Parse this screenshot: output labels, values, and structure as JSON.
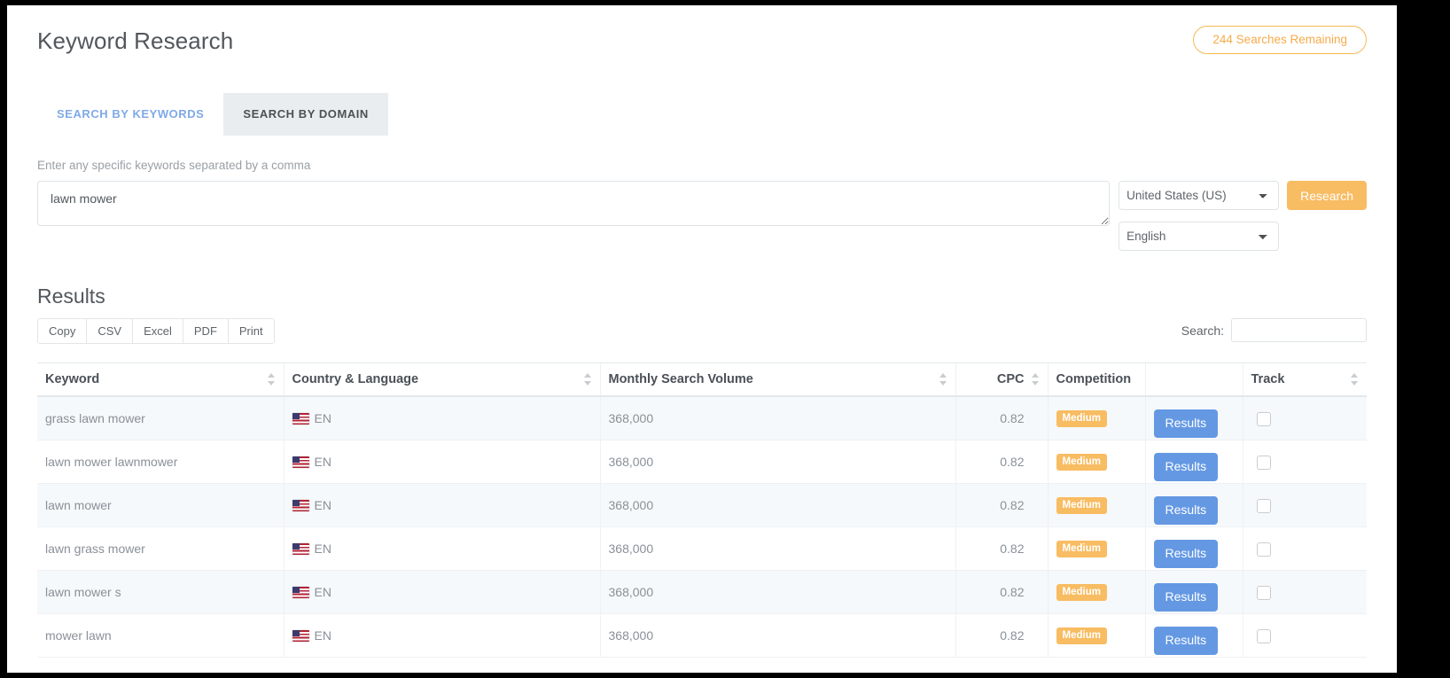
{
  "header": {
    "title": "Keyword Research",
    "searches_badge": "244 Searches Remaining",
    "badge_color": "#f6ab4a"
  },
  "tabs": [
    {
      "label": "SEARCH BY KEYWORDS",
      "active": false
    },
    {
      "label": "SEARCH BY DOMAIN",
      "active": true
    }
  ],
  "form": {
    "label": "Enter any specific keywords separated by a comma",
    "keywords_value": "lawn mower",
    "keywords_placeholder": "",
    "country_selected": "United States (US)",
    "language_selected": "English",
    "research_button": "Research",
    "research_button_color": "#f8bc62"
  },
  "results": {
    "title": "Results",
    "export_buttons": [
      "Copy",
      "CSV",
      "Excel",
      "PDF",
      "Print"
    ],
    "search_label": "Search:",
    "search_value": "",
    "search_placeholder": "",
    "columns": [
      "Keyword",
      "Country & Language",
      "Monthly Search Volume",
      "CPC",
      "Competition",
      "",
      "Track"
    ],
    "row_action_label": "Results",
    "row_action_color": "#6498e3",
    "rows": [
      {
        "keyword": "grass lawn mower",
        "flag": "us-flag-icon",
        "language": "EN",
        "volume": "368,000",
        "cpc": "0.82",
        "competition": "Medium",
        "tracked": false
      },
      {
        "keyword": "lawn mower lawnmower",
        "flag": "us-flag-icon",
        "language": "EN",
        "volume": "368,000",
        "cpc": "0.82",
        "competition": "Medium",
        "tracked": false
      },
      {
        "keyword": "lawn mower",
        "flag": "us-flag-icon",
        "language": "EN",
        "volume": "368,000",
        "cpc": "0.82",
        "competition": "Medium",
        "tracked": false
      },
      {
        "keyword": "lawn grass mower",
        "flag": "us-flag-icon",
        "language": "EN",
        "volume": "368,000",
        "cpc": "0.82",
        "competition": "Medium",
        "tracked": false
      },
      {
        "keyword": "lawn mower s",
        "flag": "us-flag-icon",
        "language": "EN",
        "volume": "368,000",
        "cpc": "0.82",
        "competition": "Medium",
        "tracked": false
      },
      {
        "keyword": "mower lawn",
        "flag": "us-flag-icon",
        "language": "EN",
        "volume": "368,000",
        "cpc": "0.82",
        "competition": "Medium",
        "tracked": false
      }
    ]
  }
}
